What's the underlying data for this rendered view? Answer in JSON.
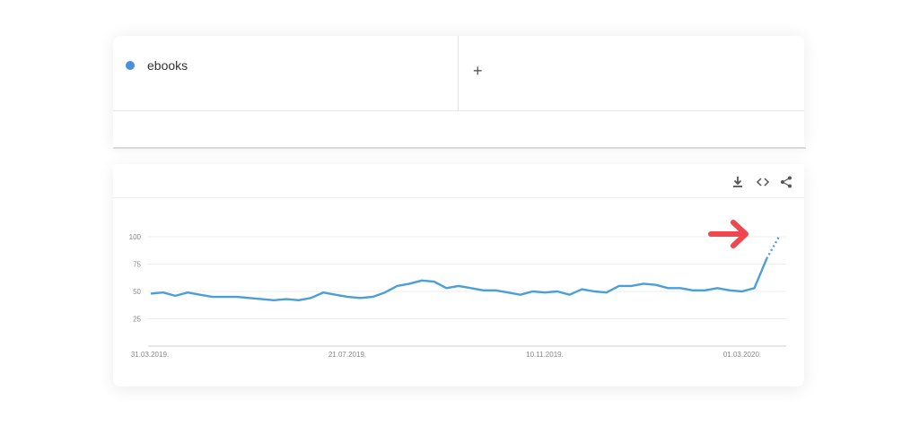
{
  "compare": {
    "term": "ebooks",
    "term_color": "#4a90d9",
    "add_symbol": "+"
  },
  "toolbar": {
    "icons": [
      "download-icon",
      "embed-code-icon",
      "share-icon"
    ]
  },
  "annotation": {
    "arrow_color": "#f0474f"
  },
  "chart_data": {
    "type": "line",
    "title": "",
    "xlabel": "",
    "ylabel": "",
    "ylim": [
      0,
      100
    ],
    "yticks": [
      25,
      50,
      75,
      100
    ],
    "x_tick_labels": [
      "31.03.2019.",
      "21.07.2019.",
      "10.11.2019.",
      "01.03.2020."
    ],
    "grid": true,
    "series": [
      {
        "color": "#4a9fd8",
        "values": [
          48,
          49,
          46,
          49,
          47,
          45,
          45,
          45,
          44,
          43,
          42,
          43,
          42,
          44,
          49,
          47,
          45,
          44,
          45,
          49,
          55,
          57,
          60,
          59,
          53,
          55,
          53,
          51,
          51,
          49,
          47,
          50,
          49,
          50,
          47,
          52,
          50,
          49,
          55,
          55,
          57,
          56,
          53,
          53,
          51,
          51,
          53,
          51,
          50,
          53,
          80,
          100
        ],
        "partial_from_index": 50
      }
    ]
  }
}
